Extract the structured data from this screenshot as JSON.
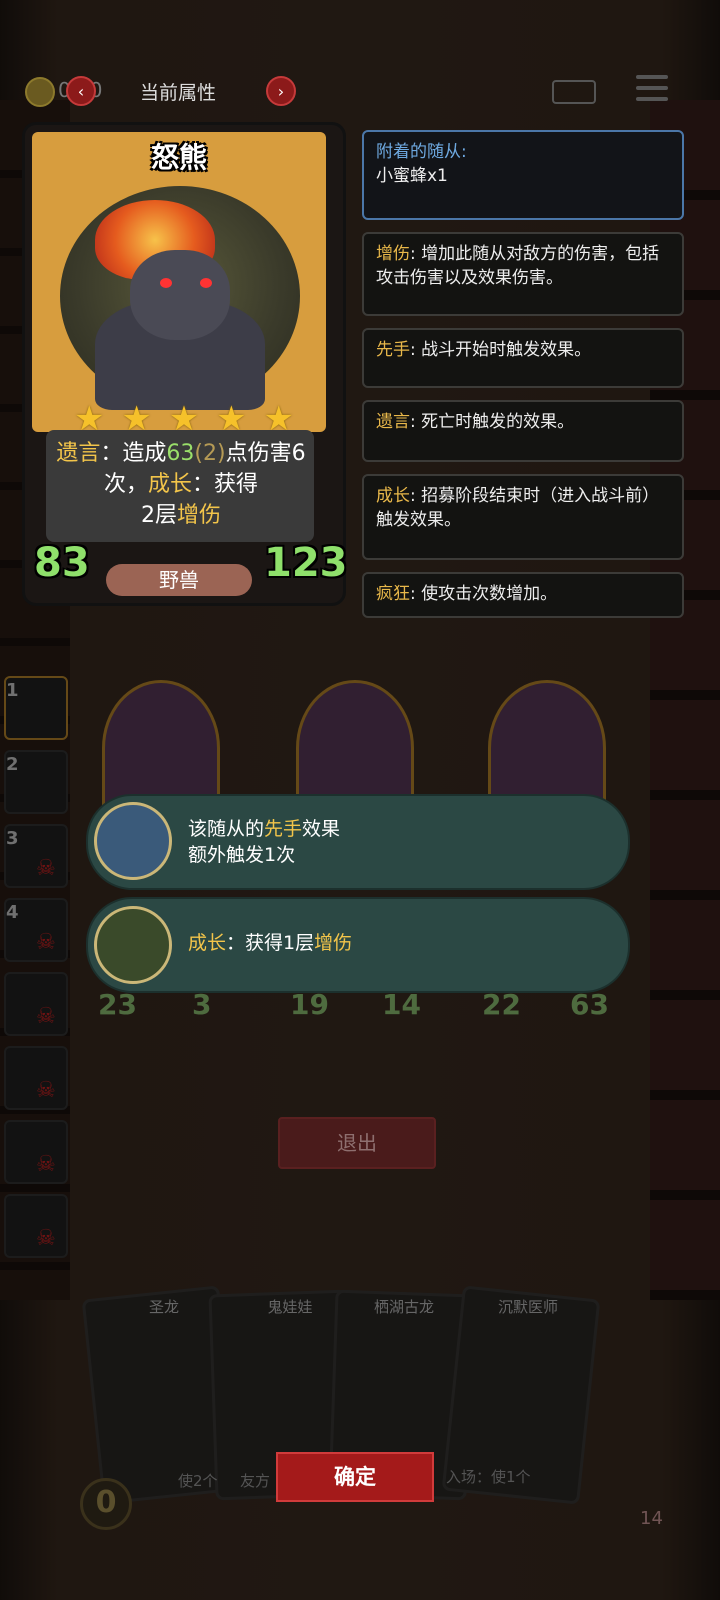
{
  "topbar": {
    "coin_text": "0 20",
    "title": "当前属性",
    "prev_icon": "chevron-left-icon",
    "next_icon": "chevron-right-icon"
  },
  "card": {
    "name": "怒熊",
    "star_count": 5,
    "desc": {
      "k1": "遗言",
      "t1": "：造成",
      "n1": "63",
      "n2": "(2)",
      "t2": "点伤害6次，",
      "k2": "成长",
      "t3": "：获得",
      "t4": "2层",
      "k3": "增伤"
    },
    "attack": "83",
    "health": "123",
    "tribe": "野兽"
  },
  "panels": {
    "attached": {
      "title": "附着的随从:",
      "body": "小蜜蜂x1"
    },
    "zengshang": {
      "key": "增伤",
      "body": ": 增加此随从对敌方的伤害，包括攻击伤害以及效果伤害。"
    },
    "xianshou": {
      "key": "先手",
      "body": ": 战斗开始时触发效果。"
    },
    "yiyan": {
      "key": "遗言",
      "body": ": 死亡时触发的效果。"
    },
    "chengzhang": {
      "key": "成长",
      "body": ": 招募阶段结束时（进入战斗前）触发效果。"
    },
    "fengkuang": {
      "key": "疯狂",
      "body": ": 使攻击次数增加。"
    }
  },
  "board": {
    "minions": [
      {
        "attack": "23",
        "health": "3"
      },
      {
        "attack": "19",
        "health": "14"
      },
      {
        "attack": "22",
        "health": "63"
      }
    ]
  },
  "side": {
    "slots": [
      "1",
      "2",
      "3",
      "4",
      "",
      "",
      "",
      ""
    ]
  },
  "popups": {
    "first": {
      "t1": "该随从的",
      "k": "先手",
      "t2": "效果",
      "line2": "额外触发1次"
    },
    "second": {
      "k": "成长",
      "t1": "：获得1层",
      "k2": "增伤"
    }
  },
  "buttons": {
    "exit": "退出",
    "confirm": "确定"
  },
  "hand": {
    "cards": [
      {
        "name": "圣龙"
      },
      {
        "name": "鬼娃娃"
      },
      {
        "name": "栖湖古龙"
      },
      {
        "name": "沉默医师"
      }
    ],
    "snippets": [
      "使2个",
      "友方",
      "入场：使1个"
    ],
    "gold": "0",
    "life": "14"
  },
  "colors": {
    "accent_gold": "#f3c54a",
    "popup_bg": "#2b4844",
    "confirm_red": "#a41a1a"
  }
}
